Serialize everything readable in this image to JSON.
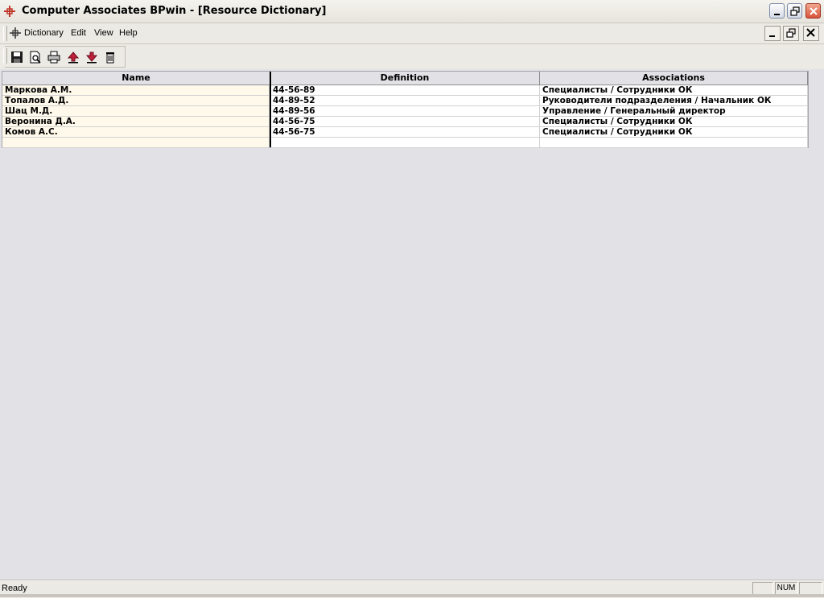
{
  "window": {
    "title": "Computer Associates BPwin - [Resource Dictionary]"
  },
  "menu": {
    "items": [
      "Dictionary",
      "Edit",
      "View",
      "Help"
    ]
  },
  "toolbar": {
    "buttons": [
      "save-icon",
      "print-preview-icon",
      "print-icon",
      "import-icon",
      "export-icon",
      "delete-icon"
    ]
  },
  "grid": {
    "columns": [
      "Name",
      "Definition",
      "Associations"
    ],
    "rows": [
      {
        "name": "Маркова А.М.",
        "definition": "44-56-89",
        "associations": "Специалисты / Сотрудники ОК"
      },
      {
        "name": "Топалов А.Д.",
        "definition": "44-89-52",
        "associations": "Руководители подразделения / Начальник ОК"
      },
      {
        "name": "Шац М.Д.",
        "definition": "44-89-56",
        "associations": "Управление / Генеральный директор"
      },
      {
        "name": "Веронина Д.А.",
        "definition": "44-56-75",
        "associations": "Специалисты / Сотрудники ОК"
      },
      {
        "name": "Комов А.С.",
        "definition": "44-56-75",
        "associations": "Специалисты / Сотрудники ОК"
      },
      {
        "name": "",
        "definition": "",
        "associations": ""
      }
    ]
  },
  "status": {
    "text": "Ready",
    "num": "NUM"
  },
  "colors": {
    "name_column_bg": "#fef9ea",
    "close_button": "#d8543a"
  }
}
